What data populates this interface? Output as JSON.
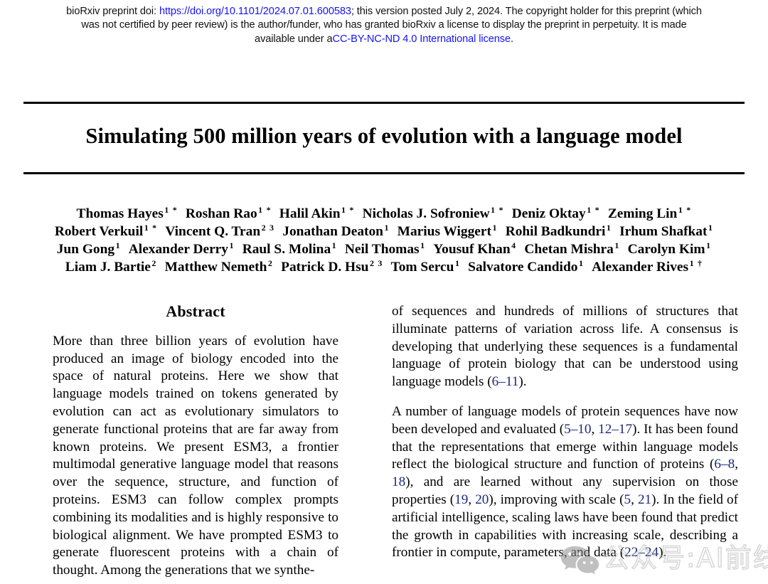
{
  "banner": {
    "line1_pre": "bioRxiv preprint doi: ",
    "doi_link": "https://doi.org/10.1101/2024.07.01.600583",
    "line1_post": "; this version posted July 2, 2024. The copyright holder for this preprint (which",
    "line2": "was not certified by peer review) is the author/funder, who has granted bioRxiv a license to display the preprint in perpetuity. It is made",
    "line3_pre": "available under a",
    "license_link": "CC-BY-NC-ND 4.0 International license",
    "line3_post": ".",
    "link_color": "#1515ef"
  },
  "paper": {
    "title": "Simulating 500 million years of evolution with a language model",
    "author_rows": [
      [
        {
          "name": "Thomas Hayes",
          "sup": "1 *"
        },
        {
          "name": "Roshan Rao",
          "sup": "1 *"
        },
        {
          "name": "Halil Akin",
          "sup": "1 *"
        },
        {
          "name": "Nicholas J. Sofroniew",
          "sup": "1 *"
        },
        {
          "name": "Deniz Oktay",
          "sup": "1 *"
        },
        {
          "name": "Zeming Lin",
          "sup": "1 *"
        }
      ],
      [
        {
          "name": "Robert Verkuil",
          "sup": "1 *"
        },
        {
          "name": "Vincent Q. Tran",
          "sup": "2 3"
        },
        {
          "name": "Jonathan Deaton",
          "sup": "1"
        },
        {
          "name": "Marius Wiggert",
          "sup": "1"
        },
        {
          "name": "Rohil Badkundri",
          "sup": "1"
        },
        {
          "name": "Irhum Shafkat",
          "sup": "1"
        }
      ],
      [
        {
          "name": "Jun Gong",
          "sup": "1"
        },
        {
          "name": "Alexander Derry",
          "sup": "1"
        },
        {
          "name": "Raul S. Molina",
          "sup": "1"
        },
        {
          "name": "Neil Thomas",
          "sup": "1"
        },
        {
          "name": "Yousuf Khan",
          "sup": "4"
        },
        {
          "name": "Chetan Mishra",
          "sup": "1"
        },
        {
          "name": "Carolyn Kim",
          "sup": "1"
        }
      ],
      [
        {
          "name": "Liam J. Bartie",
          "sup": "2"
        },
        {
          "name": "Matthew Nemeth",
          "sup": "2"
        },
        {
          "name": "Patrick D. Hsu",
          "sup": "2 3"
        },
        {
          "name": "Tom Sercu",
          "sup": "1"
        },
        {
          "name": "Salvatore Candido",
          "sup": "1"
        },
        {
          "name": "Alexander Rives",
          "sup": "1 †"
        }
      ]
    ],
    "abstract_heading": "Abstract",
    "abstract_left": "More than three billion years of evolution have produced an image of biology encoded into the space of natural proteins. Here we show that language models trained on tokens generated by evolution can act as evolutionary simulators to generate functional proteins that are far away from known proteins.  We present ESM3, a frontier multimodal generative language model that reasons over the sequence, structure, and function of proteins. ESM3 can follow complex prompts combining its modalities and is highly responsive to biological alignment. We have prompted ESM3 to generate fluorescent proteins with a chain of thought. Among the generations that we synthe-",
    "right_paragraphs": [
      {
        "segments": [
          {
            "t": "of sequences and hundreds of millions of structures that illuminate patterns of variation across life. A consensus is developing that underlying these sequences is a fundamental language of protein biology that can be understood using language models (",
            "cite": false
          },
          {
            "t": "6–11",
            "cite": true
          },
          {
            "t": ").",
            "cite": false
          }
        ]
      },
      {
        "segments": [
          {
            "t": "A number of language models of protein sequences have now been developed and evaluated (",
            "cite": false
          },
          {
            "t": "5–10",
            "cite": true
          },
          {
            "t": ", ",
            "cite": false
          },
          {
            "t": "12–17",
            "cite": true
          },
          {
            "t": ").  It has been found that the representations that emerge within language models reflect the biological structure and function of proteins (",
            "cite": false
          },
          {
            "t": "6–8",
            "cite": true
          },
          {
            "t": ", ",
            "cite": false
          },
          {
            "t": "18",
            "cite": true
          },
          {
            "t": "), and are learned without any supervision on those properties (",
            "cite": false
          },
          {
            "t": "19",
            "cite": true
          },
          {
            "t": ", ",
            "cite": false
          },
          {
            "t": "20",
            "cite": true
          },
          {
            "t": "), improving with scale (",
            "cite": false
          },
          {
            "t": "5",
            "cite": true
          },
          {
            "t": ", ",
            "cite": false
          },
          {
            "t": "21",
            "cite": true
          },
          {
            "t": "). In the field of artificial intelligence, scaling laws have been found that predict the growth in capabilities with increasing scale, describing a frontier in compute, parameters, and data (",
            "cite": false
          },
          {
            "t": "22–24",
            "cite": true
          },
          {
            "t": ").",
            "cite": false
          }
        ]
      }
    ],
    "citation_color": "#1a2a7a"
  },
  "watermark": {
    "text": "公众号:AI前线",
    "color": "#b9b9b9"
  }
}
